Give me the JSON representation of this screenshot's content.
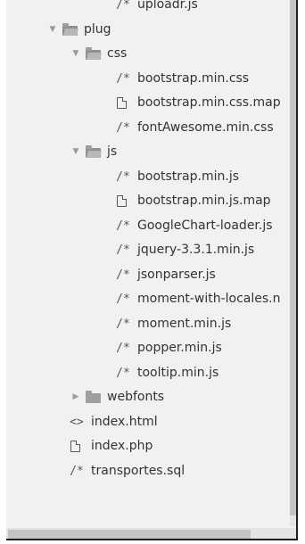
{
  "tree": [
    {
      "kind": "file",
      "icon": "comment",
      "name": "uploadr.js",
      "depth": 2
    },
    {
      "kind": "folder",
      "name": "plug",
      "expanded": true,
      "depth": 0
    },
    {
      "kind": "folder",
      "name": "css",
      "expanded": true,
      "depth": 1
    },
    {
      "kind": "file",
      "icon": "comment",
      "name": "bootstrap.min.css",
      "depth": 2
    },
    {
      "kind": "file",
      "icon": "document",
      "name": "bootstrap.min.css.map",
      "depth": 2
    },
    {
      "kind": "file",
      "icon": "comment",
      "name": "fontAwesome.min.css",
      "depth": 2
    },
    {
      "kind": "folder",
      "name": "js",
      "expanded": true,
      "depth": 1
    },
    {
      "kind": "file",
      "icon": "comment",
      "name": "bootstrap.min.js",
      "depth": 2
    },
    {
      "kind": "file",
      "icon": "document",
      "name": "bootstrap.min.js.map",
      "depth": 2
    },
    {
      "kind": "file",
      "icon": "comment",
      "name": "GoogleChart-loader.js",
      "depth": 2
    },
    {
      "kind": "file",
      "icon": "comment",
      "name": "jquery-3.3.1.min.js",
      "depth": 2
    },
    {
      "kind": "file",
      "icon": "comment",
      "name": "jsonparser.js",
      "depth": 2
    },
    {
      "kind": "file",
      "icon": "comment",
      "name": "moment-with-locales.n",
      "depth": 2
    },
    {
      "kind": "file",
      "icon": "comment",
      "name": "moment.min.js",
      "depth": 2
    },
    {
      "kind": "file",
      "icon": "comment",
      "name": "popper.min.js",
      "depth": 2
    },
    {
      "kind": "file",
      "icon": "comment",
      "name": "tooltip.min.js",
      "depth": 2
    },
    {
      "kind": "folder",
      "name": "webfonts",
      "expanded": false,
      "depth": 1
    },
    {
      "kind": "file",
      "icon": "code",
      "name": "index.html",
      "depth": 0
    },
    {
      "kind": "file",
      "icon": "document",
      "name": "index.php",
      "depth": 0
    },
    {
      "kind": "file",
      "icon": "comment",
      "name": "transportes.sql",
      "depth": 0
    }
  ],
  "glyphs": {
    "expanded": "▼",
    "collapsed": "▶",
    "comment": "/*",
    "code": "<>"
  },
  "colors": {
    "panel_background": "#f1f1f1",
    "folder_icon": "#9e9e9e",
    "text": "#333333"
  }
}
